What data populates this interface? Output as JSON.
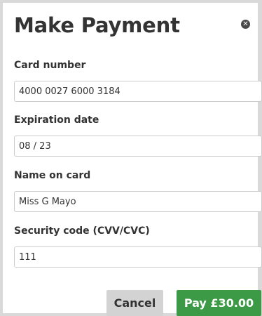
{
  "modal": {
    "title": "Make Payment",
    "close_icon": "close-circle-icon"
  },
  "form": {
    "card_number": {
      "label": "Card number",
      "value": "4000 0027 6000 3184"
    },
    "expiration": {
      "label": "Expiration date",
      "value": "08 / 23"
    },
    "name": {
      "label": "Name on card",
      "value": "Miss G Mayo"
    },
    "security_code": {
      "label": "Security code (CVV/CVC)",
      "value": "111"
    }
  },
  "actions": {
    "cancel_label": "Cancel",
    "pay_label": "Pay £30.00"
  },
  "colors": {
    "pay_button": "#3c9a46",
    "cancel_button": "#d3d3d3",
    "backdrop": "#d9d9d9"
  }
}
